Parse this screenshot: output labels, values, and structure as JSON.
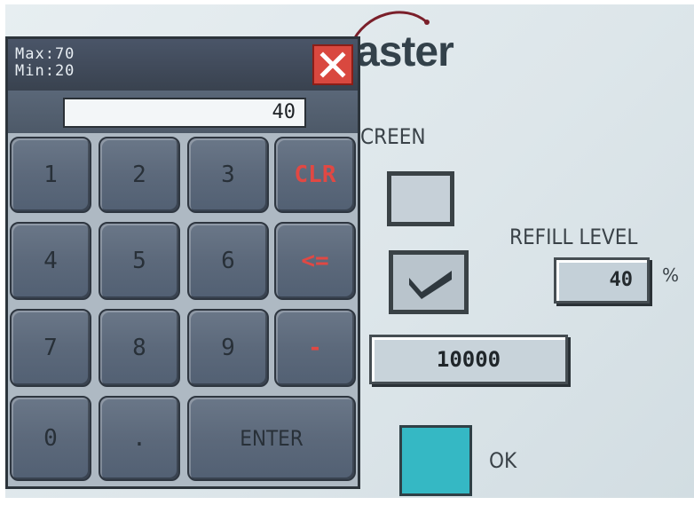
{
  "app": {
    "logo_text": "aster"
  },
  "screen_label": "CREEN",
  "refill": {
    "label": "REFILL LEVEL",
    "value": "40",
    "unit": "%"
  },
  "long_field_value": "10000",
  "ok_label": "OK",
  "colors": {
    "ok_indicator": "#35b8c4",
    "close_button": "#d9483f",
    "key_accent": "#e14843"
  },
  "keypad": {
    "max_label": "Max:70",
    "min_label": "Min:20",
    "display_value": "40",
    "close_icon": "close-icon",
    "keys": {
      "k1": "1",
      "k2": "2",
      "k3": "3",
      "clr": "CLR",
      "k4": "4",
      "k5": "5",
      "k6": "6",
      "back": "<=",
      "k7": "7",
      "k8": "8",
      "k9": "9",
      "minus": "-",
      "k0": "0",
      "dot": ".",
      "enter": "ENTER"
    }
  }
}
